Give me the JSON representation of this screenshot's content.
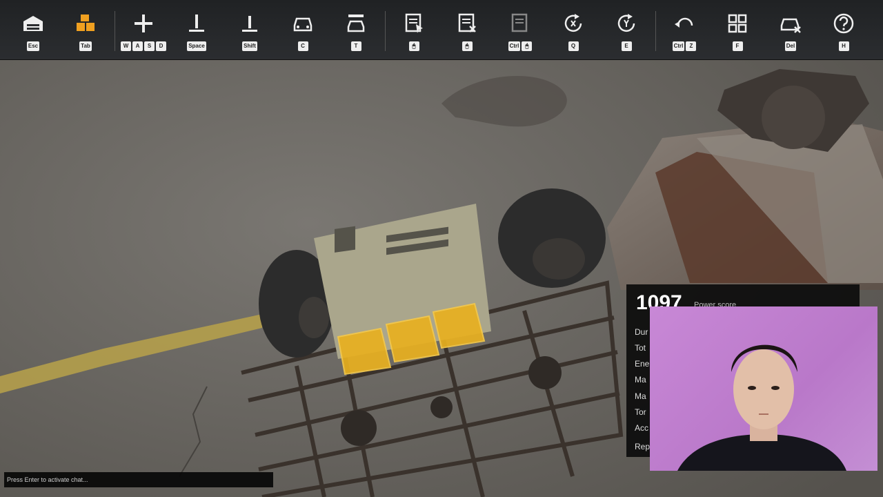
{
  "toolbar": {
    "items": [
      {
        "icon": "garage-icon",
        "keys": [
          "Esc"
        ],
        "active": false
      },
      {
        "icon": "parts-icon",
        "keys": [
          "Tab"
        ],
        "active": true
      },
      {
        "icon": "move-icon",
        "keys": [
          "W",
          "A",
          "S",
          "D"
        ],
        "active": false
      },
      {
        "icon": "camera-up-icon",
        "keys": [
          "Space"
        ],
        "active": false
      },
      {
        "icon": "camera-down-icon",
        "keys": [
          "Shift"
        ],
        "active": false
      },
      {
        "icon": "car-view-icon",
        "keys": [
          "C"
        ],
        "active": false
      },
      {
        "icon": "car-lift-icon",
        "keys": [
          "T"
        ],
        "active": false
      },
      {
        "icon": "place-part-icon",
        "keys": [
          "🖱"
        ],
        "active": false
      },
      {
        "icon": "remove-part-icon",
        "keys": [
          "🖱"
        ],
        "active": false
      },
      {
        "icon": "paint-part-icon",
        "keys": [
          "Ctrl",
          "🖱"
        ],
        "active": false
      },
      {
        "icon": "rotate-x-icon",
        "keys": [
          "Q"
        ],
        "active": false
      },
      {
        "icon": "rotate-y-icon",
        "keys": [
          "E"
        ],
        "active": false
      },
      {
        "icon": "undo-icon",
        "keys": [
          "Ctrl",
          "Z"
        ],
        "active": false
      },
      {
        "icon": "grid-icon",
        "keys": [
          "F"
        ],
        "active": false
      },
      {
        "icon": "car-delete-icon",
        "keys": [
          "Del"
        ],
        "active": false
      },
      {
        "icon": "help-icon",
        "keys": [
          "H"
        ],
        "active": false
      }
    ]
  },
  "power_panel": {
    "score": "1097",
    "label": "Power score",
    "stats": [
      "Dur",
      "Tot",
      "Ene",
      "Ma",
      "Ma",
      "Tor",
      "Acc",
      "Rep"
    ]
  },
  "chat": {
    "placeholder": "Press Enter to activate chat..."
  },
  "colors": {
    "accent": "#f0a020",
    "highlight": "#e8b020",
    "toolbar_bg": "#25272a",
    "webcam_bg": "#c084d0"
  }
}
